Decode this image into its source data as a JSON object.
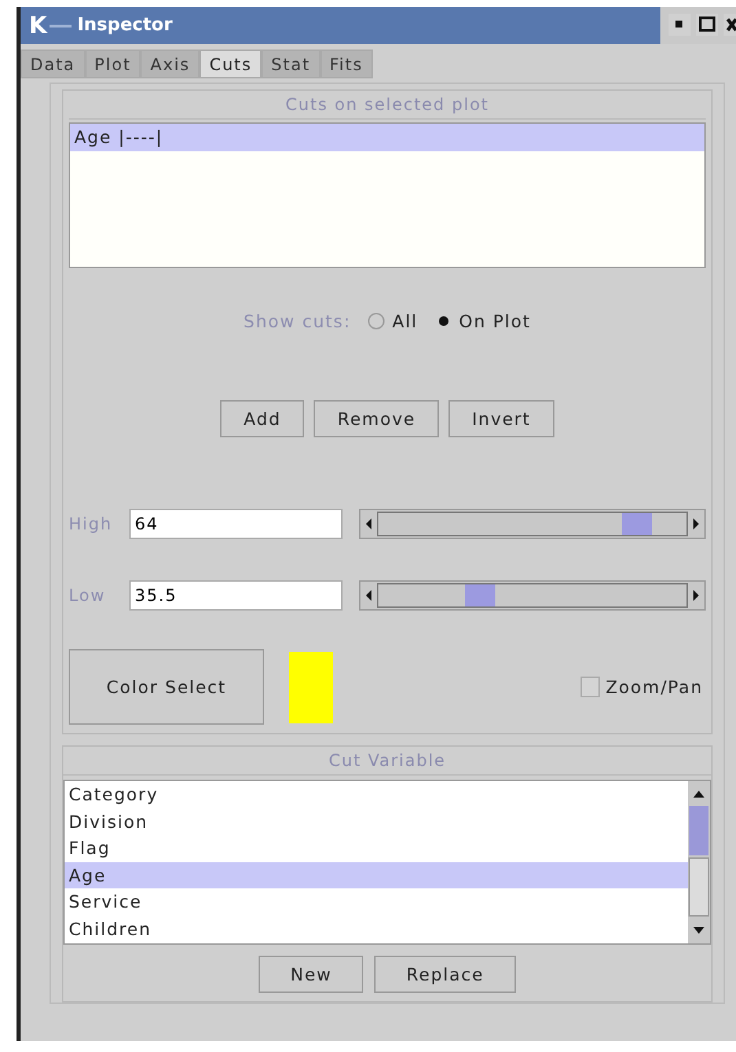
{
  "window": {
    "title": "Inspector",
    "logo": "K"
  },
  "tabs": [
    {
      "label": "Data",
      "selected": false
    },
    {
      "label": "Plot",
      "selected": false
    },
    {
      "label": "Axis",
      "selected": false
    },
    {
      "label": "Cuts",
      "selected": true
    },
    {
      "label": "Stat",
      "selected": false
    },
    {
      "label": "Fits",
      "selected": false
    }
  ],
  "cuts_panel": {
    "title": "Cuts on selected plot",
    "items": [
      {
        "label": "Age  |----|",
        "selected": true
      }
    ]
  },
  "show_cuts": {
    "label": "Show cuts:",
    "options": [
      {
        "label": "All",
        "selected": false
      },
      {
        "label": "On Plot",
        "selected": true
      }
    ]
  },
  "actions": [
    "Add",
    "Remove",
    "Invert"
  ],
  "ranges": [
    {
      "label": "High",
      "value": "64",
      "level": 0.84
    },
    {
      "label": "Low",
      "value": "35.5",
      "level": 0.33
    }
  ],
  "color_select": {
    "label": "Color Select",
    "color": "#ffff00"
  },
  "zoom_pan": {
    "label": "Zoom/Pan",
    "checked": false
  },
  "cut_variable": {
    "title": "Cut Variable",
    "items": [
      {
        "label": "Category",
        "selected": false
      },
      {
        "label": "Division",
        "selected": false
      },
      {
        "label": "Flag",
        "selected": false
      },
      {
        "label": "Age",
        "selected": true
      },
      {
        "label": "Service",
        "selected": false
      },
      {
        "label": "Children",
        "selected": false
      }
    ],
    "buttons": [
      "New",
      "Replace"
    ]
  }
}
